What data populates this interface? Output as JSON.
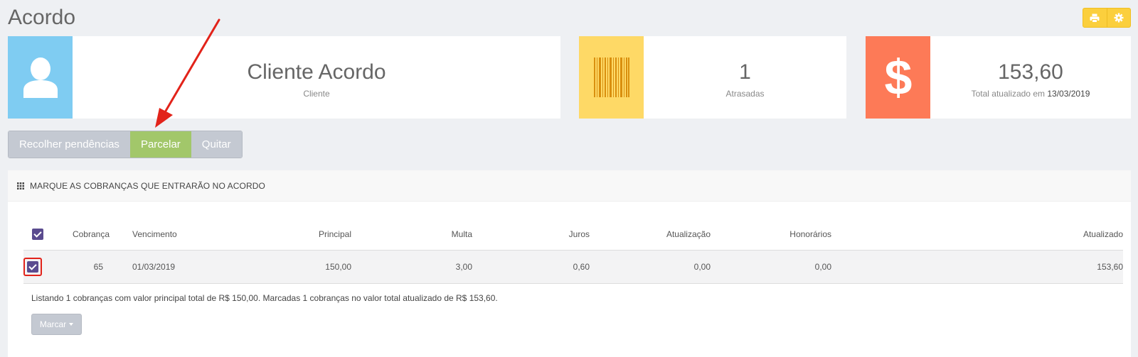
{
  "page": {
    "title": "Acordo"
  },
  "toolbar": {
    "print_icon": "print-icon",
    "settings_icon": "gear-icon",
    "color": "#fbcf3d"
  },
  "cards": {
    "client": {
      "name": "Cliente Acordo",
      "label": "Cliente",
      "icon": "user-icon",
      "color": "#7fccf2"
    },
    "overdue": {
      "count": "1",
      "label": "Atrasadas",
      "icon": "barcode-icon",
      "color": "#fed966"
    },
    "total": {
      "value": "153,60",
      "label_prefix": "Total atualizado em",
      "date": "13/03/2019",
      "icon": "dollar-icon",
      "color": "#fd7a57"
    }
  },
  "actions": {
    "collect": "Recolher pendências",
    "installments": "Parcelar",
    "settle": "Quitar",
    "active": "installments",
    "active_color": "#a2c76a"
  },
  "panel": {
    "title": "MARQUE AS COBRANÇAS QUE ENTRARÃO NO ACORDO",
    "icon": "grid-icon",
    "columns": {
      "charge": "Cobrança",
      "due": "Vencimento",
      "principal": "Principal",
      "fine": "Multa",
      "interest": "Juros",
      "update": "Atualização",
      "fees": "Honorários",
      "updated": "Atualizado"
    },
    "rows": [
      {
        "checked": true,
        "charge": "65",
        "due": "01/03/2019",
        "principal": "150,00",
        "fine": "3,00",
        "interest": "0,60",
        "update": "0,00",
        "fees": "0,00",
        "updated": "153,60"
      }
    ],
    "summary": "Listando 1 cobranças com valor principal total de R$ 150,00. Marcadas 1 cobranças no valor total atualizado de R$ 153,60.",
    "mark_button": "Marcar"
  }
}
